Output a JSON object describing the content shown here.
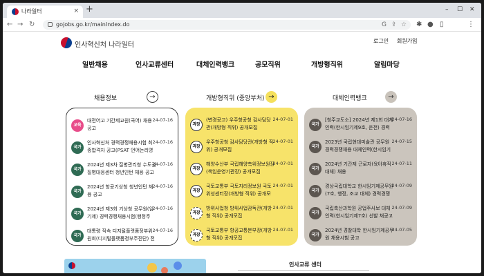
{
  "browser": {
    "tab_title": "나라일터",
    "tab_close": "×",
    "new_tab": "+",
    "url": "gojobs.go.kr/mainIndex.do",
    "icons": [
      "back-icon",
      "forward-icon",
      "reload-icon",
      "google-icon",
      "share-icon",
      "bookmark-star-icon",
      "extensions-icon",
      "sidepanel-icon",
      "menu-dots-icon"
    ]
  },
  "site": {
    "logo_text": "인사혁신처 나라일터",
    "login": "로그인",
    "signup": "회원가입",
    "nav": [
      "일반채용",
      "인사교류센터",
      "대체인력뱅크",
      "공모직위",
      "개방형직위",
      "알림마당"
    ]
  },
  "sections": {
    "recruit": {
      "title": "채용정보",
      "items": [
        {
          "badge": "교육",
          "text": "대전어고 기간제교원(국어) 채용공고",
          "date": "24-07-16"
        },
        {
          "badge": "국가",
          "text": "인사혁신처 경력경쟁채용시험 최종합격자 공고(PSAT 언어논리영역,",
          "date": "24-07-16"
        },
        {
          "badge": "국가",
          "text": "2024년 제3차 질병관리청 수도권질병대응센터 청년인턴 채용 공고",
          "date": "24-07-16"
        },
        {
          "badge": "국가",
          "text": "2024년 항공기상청 청년인턴 채용 공고",
          "date": "24-07-16"
        },
        {
          "badge": "국가",
          "text": "2024년 제3회 기상청 공무원(임기제) 경력경쟁채용시험(행정주",
          "date": "24-07-16"
        },
        {
          "badge": "국가",
          "text": "대통령 직속 디지털플랫폼정부위원회(디지털플랫폼정부주진단) 전문",
          "date": "24-07-16"
        }
      ]
    },
    "open": {
      "title": "개방형직위 (중앙부처)",
      "items": [
        {
          "badge": "과장",
          "text": "(변경공고) 우주항공청 감사담당관(개방형 직위) 공개모집",
          "date": "24-07-01"
        },
        {
          "badge": "과장",
          "text": "우주항공청 감사담당관(개방형 직위) 공개모집",
          "date": "24-07-01"
        },
        {
          "badge": "과장",
          "text": "해양수산부 국립해양측위정보원장(책임운영기관장) 공개모집",
          "date": "24-07-01"
        },
        {
          "badge": "과장",
          "text": "국토교통부 국토지리정보원 국토위성센터장(개방형 직위) 공개모집",
          "date": "24-07-01"
        },
        {
          "badge": "과장",
          "text": "방위사업청 방위사업감독관(개방형 직위) 공개모집",
          "date": "24-07-01"
        },
        {
          "badge": "과장",
          "text": "국토교통부 항공교통본부장(개방형 직위) 공개모집",
          "date": "24-07-01"
        }
      ]
    },
    "substitute": {
      "title": "대체인력뱅크",
      "items": [
        {
          "badge": "국가",
          "text": "[청주교도소] 2024년 제1회 대체인력(한시임기제9호, 운전) 경력경쟁",
          "date": "24-07-16"
        },
        {
          "badge": "국가",
          "text": "2023년 국립현대미술관 공무원 경력경쟁채용 대체인력(한시임기제6",
          "date": "24-07-15"
        },
        {
          "badge": "국가",
          "text": "2024년 기간제 근로자(육아휴직대체) 채용",
          "date": "24-07-11"
        },
        {
          "badge": "국가",
          "text": "경상국립대학교 한시임기제공무원(7호, 행정, 조교 대체) 경력경쟁채",
          "date": "24-07-09"
        },
        {
          "badge": "국가",
          "text": "국립축산과학원 공업주사보 대체인력(한시임기제7호) 선발 채공고",
          "date": "24-07-09"
        },
        {
          "badge": "국가",
          "text": "2024년 경찰대학 한시임기제공무원 채용시험 공고",
          "date": "24-07-05"
        }
      ]
    }
  },
  "bottom": {
    "exchange_title": "인사교류 센터"
  },
  "colors": {
    "yellow_panel": "#f7e36a",
    "grey_panel": "#cbc5bd",
    "edu_badge": "#e84d8a",
    "national_badge": "#2f6b54",
    "grey_badge": "#5c5650"
  }
}
